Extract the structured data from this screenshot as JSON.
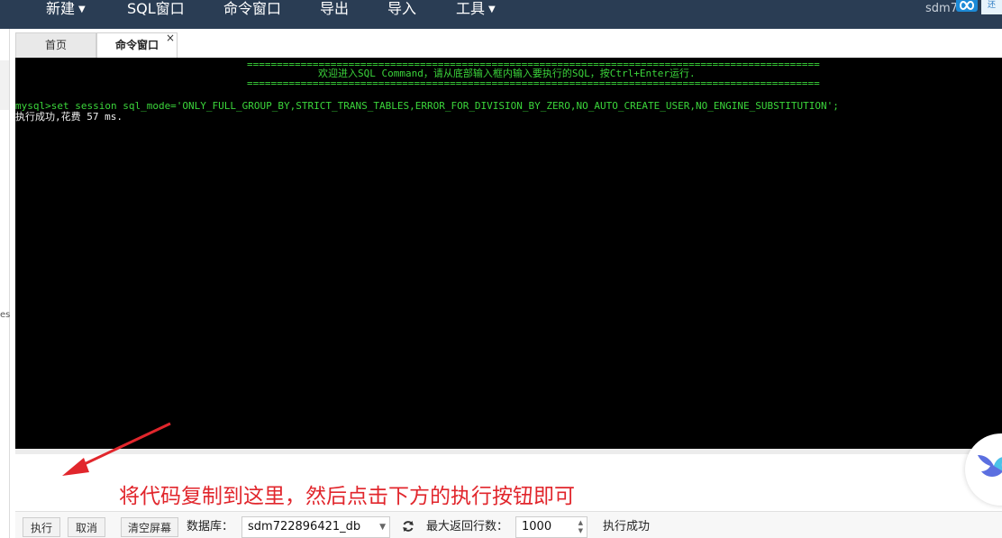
{
  "menu": {
    "items": [
      {
        "label": "新建",
        "has_dropdown": true
      },
      {
        "label": "SQL窗口",
        "has_dropdown": false
      },
      {
        "label": "命令窗口",
        "has_dropdown": false
      },
      {
        "label": "导出",
        "has_dropdown": false
      },
      {
        "label": "导入",
        "has_dropdown": false
      },
      {
        "label": "工具",
        "has_dropdown": true
      }
    ],
    "user": "sdm7",
    "corner_tag": "还"
  },
  "sidebar": {
    "fragment": "es"
  },
  "tabs": [
    {
      "label": "首页",
      "active": false
    },
    {
      "label": "命令窗口",
      "active": true,
      "close": "×"
    }
  ],
  "console": {
    "separator": "================================================================================================",
    "welcome": "欢迎进入SQL Command，请从底部输入框内输入要执行的SQL，按Ctrl+Enter运行.",
    "command": "mysql>set session sql_mode='ONLY_FULL_GROUP_BY,STRICT_TRANS_TABLES,ERROR_FOR_DIVISION_BY_ZERO,NO_AUTO_CREATE_USER,NO_ENGINE_SUBSTITUTION';",
    "result": "执行成功,花费 57 ms."
  },
  "input": {
    "annotation": "将代码复制到这里，然后点击下方的执行按钮即可"
  },
  "toolbar": {
    "execute": "执行",
    "cancel": "取消",
    "clear": "清空屏幕",
    "database_label": "数据库：",
    "database_value": "sdm722896421_db",
    "max_rows_label": "最大返回行数：",
    "max_rows_value": "1000",
    "status": "执行成功"
  },
  "colors": {
    "menubar": "#2a3d54",
    "console_bg": "#000000",
    "console_green": "#3bd53b",
    "annotation_red": "#e1262c"
  }
}
